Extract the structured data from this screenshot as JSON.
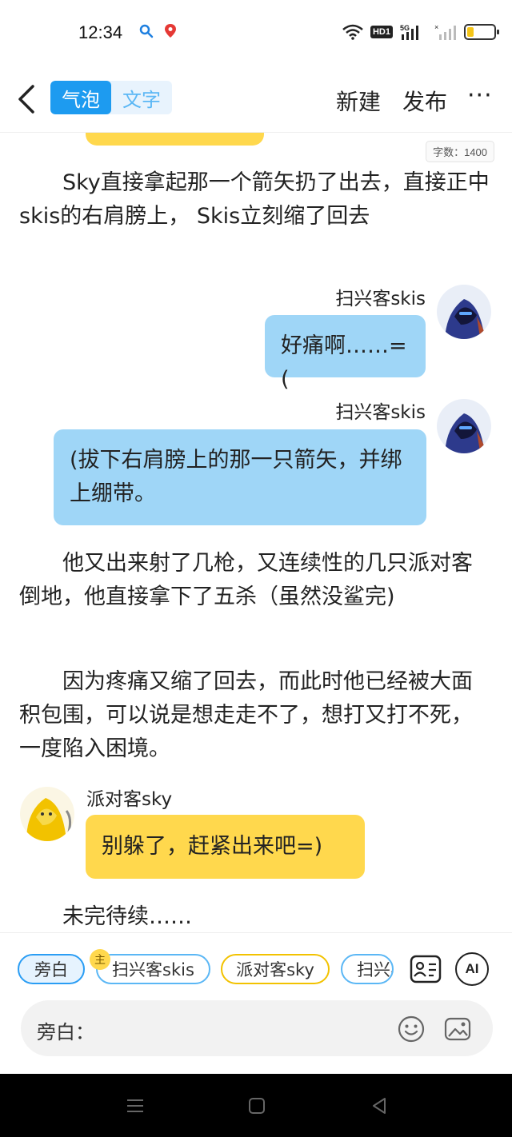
{
  "status_bar": {
    "time": "12:34",
    "hd_label": "HD1",
    "network_label": "5G",
    "icons": [
      "search-icon",
      "location-pin-icon",
      "wifi-icon",
      "signal-icon",
      "battery-icon"
    ],
    "battery_level": 0.25
  },
  "header": {
    "mode_bubble": "气泡",
    "mode_text": "文字",
    "new_label": "新建",
    "publish_label": "发布",
    "more_label": "···"
  },
  "content": {
    "word_count": "字数：1400",
    "paragraph_1": "Sky直接拿起那一个箭矢扔了出去，直接正中skis的右肩膀上， Skis立刻缩了回去",
    "msg_1": {
      "speaker": "扫兴客skis",
      "text": "好痛啊……=("
    },
    "msg_2": {
      "speaker": "扫兴客skis",
      "text": "(拔下右肩膀上的那一只箭矢，并绑上绷带。"
    },
    "paragraph_2": "他又出来射了几枪，又连续性的几只派对客倒地，他直接拿下了五杀（虽然没鲨完)",
    "paragraph_3": "因为疼痛又缩了回去，而此时他已经被大面积包围，可以说是想走走不了，想打又打不死，一度陷入困境。",
    "msg_3": {
      "speaker": "派对客sky",
      "text": "别躲了，赶紧出来吧=)"
    },
    "paragraph_4": "未完待续……"
  },
  "toolbar": {
    "chip_narrator": "旁白",
    "host_badge": "主",
    "chip_skis": "扫兴客skis",
    "chip_sky": "派对客sky",
    "chip_skis_2": "扫兴客skis",
    "ai_label": "AI",
    "input_label": "旁白："
  },
  "colors": {
    "accent_blue": "#1d9bf0",
    "bubble_blue": "#9fd6f7",
    "bubble_yellow": "#ffd84d"
  }
}
